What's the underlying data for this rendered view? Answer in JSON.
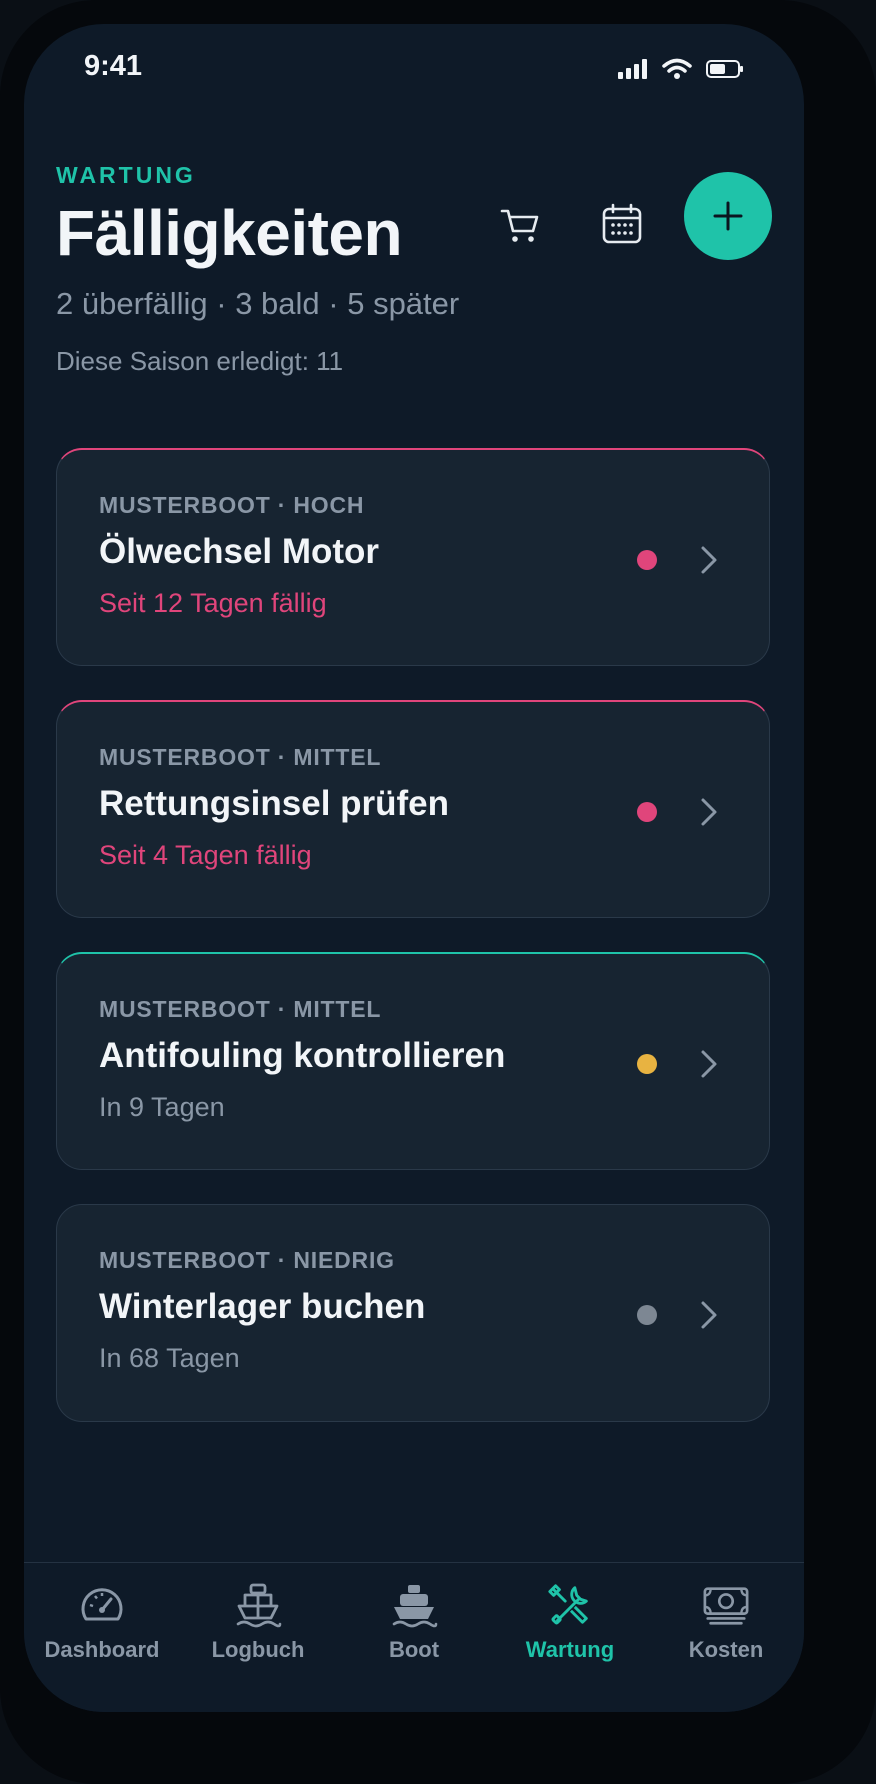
{
  "status": {
    "time": "9:41"
  },
  "header": {
    "eyebrow": "WARTUNG",
    "title": "Fälligkeiten",
    "subtitle": "2 überfällig · 3 bald · 5 später",
    "meta": "Diese Saison erledigt: 11"
  },
  "actions": {
    "cart_icon": "cart-icon",
    "calendar_icon": "calendar-icon",
    "add_icon": "plus-icon"
  },
  "tasks": [
    {
      "label": "MUSTERBOOT · HOCH",
      "name": "Ölwechsel Motor",
      "due": "Seit 12 Tagen fällig",
      "dot_color": "#e0457b"
    },
    {
      "label": "MUSTERBOOT · MITTEL",
      "name": "Rettungsinsel prüfen",
      "due": "Seit 4 Tagen fällig",
      "dot_color": "#e0457b"
    },
    {
      "label": "MUSTERBOOT · MITTEL",
      "name": "Antifouling kontrollieren",
      "due": "In 9 Tagen",
      "dot_color": "#e8b341"
    },
    {
      "label": "MUSTERBOOT · NIEDRIG",
      "name": "Winterlager buchen",
      "due": "In 68 Tagen",
      "dot_color": "#7d8793"
    }
  ],
  "tabs": [
    {
      "label": "Dashboard",
      "icon": "gauge-icon"
    },
    {
      "label": "Logbuch",
      "icon": "ship-outline-icon"
    },
    {
      "label": "Boot",
      "icon": "boat-icon"
    },
    {
      "label": "Wartung",
      "icon": "tools-icon",
      "active": true
    },
    {
      "label": "Kosten",
      "icon": "banknote-icon"
    }
  ],
  "colors": {
    "accent": "#1fc3a9",
    "danger": "#e0457b",
    "warning": "#e8b341",
    "neutral": "#7d8793",
    "background": "#0e1a28",
    "card": "#172431"
  }
}
